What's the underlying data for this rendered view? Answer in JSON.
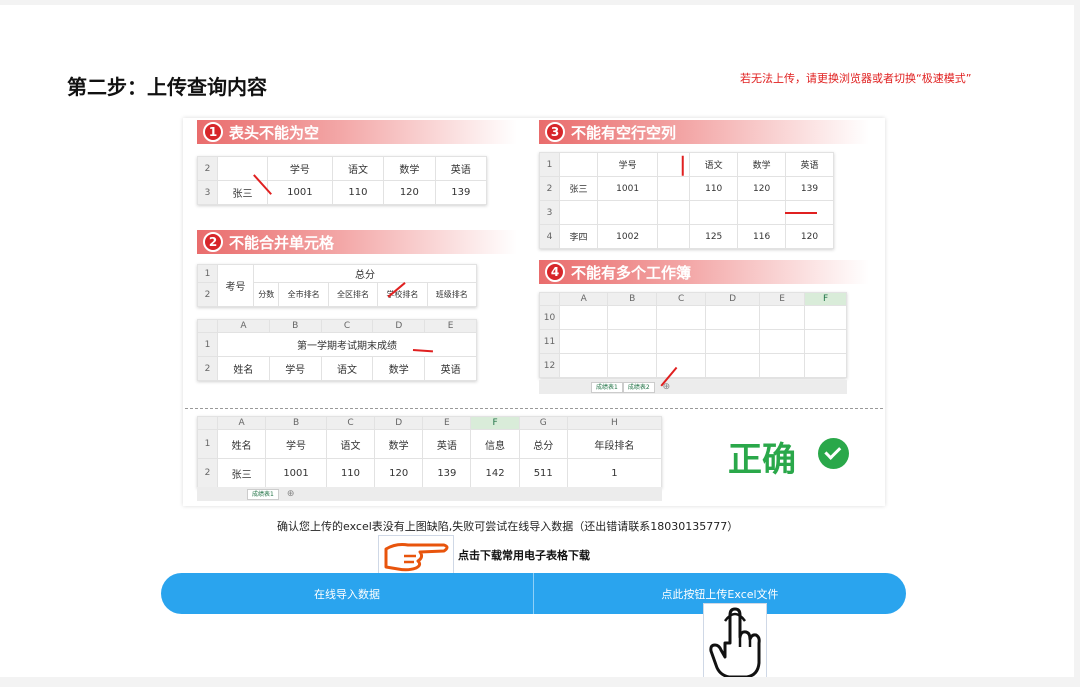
{
  "step_title": "第二步：上传查询内容",
  "hint": "若无法上传，请更换浏览器或者切换“极速模式”",
  "rules": [
    {
      "num": "1",
      "title": "表头不能为空"
    },
    {
      "num": "2",
      "title": "不能合并单元格"
    },
    {
      "num": "3",
      "title": "不能有空行空列"
    },
    {
      "num": "4",
      "title": "不能有多个工作簿"
    }
  ],
  "ex1": {
    "rows": [
      "2",
      "3"
    ],
    "header": [
      "",
      "学号",
      "语文",
      "数学",
      "英语"
    ],
    "data": [
      "张三",
      "1001",
      "110",
      "120",
      "139"
    ]
  },
  "ex2a": {
    "rows": [
      "1",
      "2"
    ],
    "kaohao": "考号",
    "zongfen": "总分",
    "sub": [
      "分数",
      "全市排名",
      "全区排名",
      "学校排名",
      "班级排名"
    ]
  },
  "ex2b": {
    "cols": [
      "A",
      "B",
      "C",
      "D",
      "E"
    ],
    "rows": [
      "1",
      "2"
    ],
    "merged": "第一学期考试期末成绩",
    "header": [
      "姓名",
      "学号",
      "语文",
      "数学",
      "英语"
    ]
  },
  "ex3": {
    "rows": [
      "1",
      "2",
      "3",
      "4"
    ],
    "header": [
      "",
      "学号",
      "",
      "语文",
      "数学",
      "英语"
    ],
    "r2": [
      "张三",
      "1001",
      "",
      "110",
      "120",
      "139"
    ],
    "r4": [
      "李四",
      "1002",
      "",
      "125",
      "116",
      "120"
    ]
  },
  "ex4": {
    "cols": [
      "A",
      "B",
      "C",
      "D",
      "E",
      "F"
    ],
    "rows": [
      "10",
      "11",
      "12"
    ],
    "tabs": [
      "成绩表1",
      "成绩表2"
    ],
    "plus": "⊕"
  },
  "correct_table": {
    "cols": [
      "A",
      "B",
      "C",
      "D",
      "E",
      "F",
      "G",
      "H"
    ],
    "rows": [
      "1",
      "2"
    ],
    "header": [
      "姓名",
      "学号",
      "语文",
      "数学",
      "英语",
      "信息",
      "总分",
      "年段排名"
    ],
    "data": [
      "张三",
      "1001",
      "110",
      "120",
      "139",
      "142",
      "511",
      "1"
    ],
    "tab": "成绩表1",
    "plus": "⊕"
  },
  "correct_label": "正确",
  "confirm_text": "确认您上传的excel表没有上图缺陷,失败可尝试在线导入数据（还出错请联系18030135777）",
  "download_link": "点击下载常用电子表格下载",
  "buttons": {
    "online_import": "在线导入数据",
    "upload_excel": "点此按钮上传Excel文件"
  },
  "colors": {
    "accent_blue": "#2aa4ee",
    "correct_green": "#2aa84a",
    "warning_red": "#e02020",
    "banner_red": "#e96c6c",
    "hand_orange": "#e8540c"
  }
}
